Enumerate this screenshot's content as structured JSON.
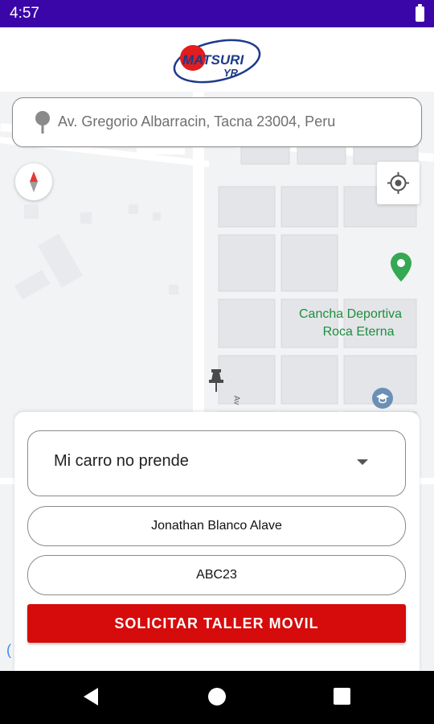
{
  "status_bar": {
    "time": "4:57"
  },
  "header": {
    "logo_text_top": "MATSURI",
    "logo_text_bottom": "YR"
  },
  "map": {
    "address": "Av. Gregorio Albarracin, Tacna 23004, Peru",
    "poi_label_line1": "Cancha Deportiva",
    "poi_label_line2": "Roca Eterna",
    "street_label": "Av"
  },
  "form": {
    "problem_selected": "Mi carro no prende",
    "name_value": "Jonathan Blanco Alave",
    "plate_value": "ABC23",
    "submit_label": "SOLICITAR TALLER MOVIL"
  },
  "colors": {
    "status_bar": "#3a06a8",
    "submit": "#d60b0b",
    "poi": "#1e8e3e",
    "logo_blue": "#1e3a8a",
    "logo_red": "#e11d1d"
  },
  "icons": {
    "search_pin": "map-pin-icon",
    "compass": "compass-icon",
    "locate": "my-location-icon",
    "poi": "green-place-icon",
    "school": "school-icon",
    "marker": "push-pin-icon"
  }
}
